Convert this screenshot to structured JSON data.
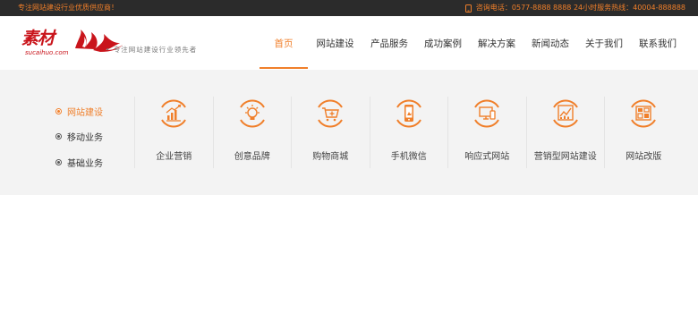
{
  "topbar": {
    "slogan": "专注网站建设行业优质供应商！",
    "contact": "咨询电话：0577-8888 8888   24小时服务热线：40004-888888"
  },
  "logo": {
    "main": "素材",
    "sub": "sucaihuo.com",
    "tagline": "专注网站建设行业领先者"
  },
  "nav": {
    "items": [
      {
        "label": "首页",
        "active": true
      },
      {
        "label": "网站建设"
      },
      {
        "label": "产品服务"
      },
      {
        "label": "成功案例"
      },
      {
        "label": "解决方案"
      },
      {
        "label": "新闻动态"
      },
      {
        "label": "关于我们"
      },
      {
        "label": "联系我们"
      }
    ]
  },
  "side": {
    "items": [
      {
        "label": "网站建设",
        "active": true
      },
      {
        "label": "移动业务"
      },
      {
        "label": "基础业务"
      }
    ]
  },
  "services": [
    {
      "label": "企业营销",
      "icon": "chart-growth-icon"
    },
    {
      "label": "创意品牌",
      "icon": "lightbulb-icon"
    },
    {
      "label": "购物商城",
      "icon": "shopping-cart-icon"
    },
    {
      "label": "手机微信",
      "icon": "mobile-phone-icon"
    },
    {
      "label": "响应式网站",
      "icon": "responsive-devices-icon"
    },
    {
      "label": "营销型网站建设",
      "icon": "marketing-chart-icon"
    },
    {
      "label": "网站改版",
      "icon": "layout-redesign-icon"
    }
  ],
  "colors": {
    "accent": "#f07f2a",
    "topbar_bg": "#2b2b2b",
    "logo_red": "#c9141b",
    "panel_bg": "#f3f3f3"
  }
}
